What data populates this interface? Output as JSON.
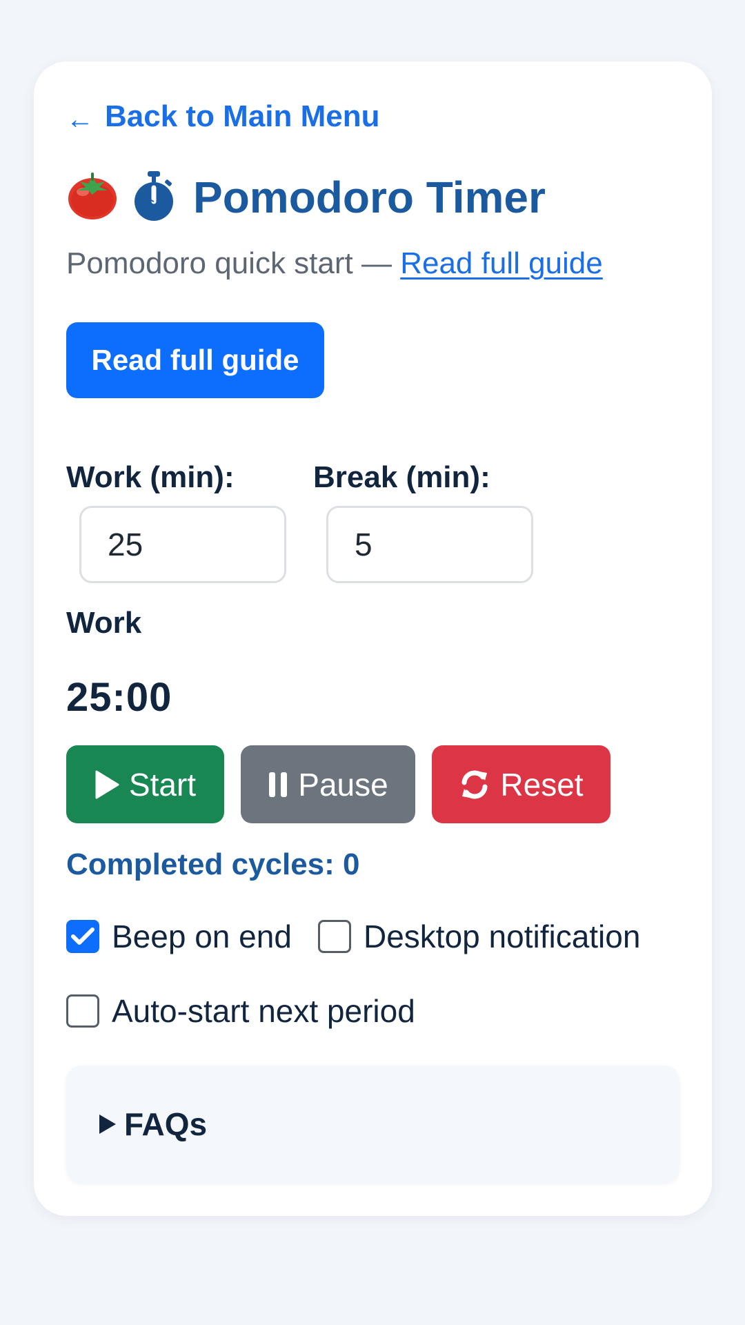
{
  "nav": {
    "back_arrow": "←",
    "back_label": "Back to Main Menu"
  },
  "header": {
    "title": "Pomodoro Timer",
    "icons": [
      "tomato-icon",
      "stopwatch-icon"
    ]
  },
  "subtitle": {
    "text": "Pomodoro quick start — ",
    "link_label": "Read full guide"
  },
  "guide_button": {
    "label": "Read full guide"
  },
  "settings": {
    "work_label": "Work (min):",
    "work_value": "25",
    "break_label": "Break (min):",
    "break_value": "5"
  },
  "timer": {
    "phase": "Work",
    "time": "25:00"
  },
  "controls": {
    "start_label": "Start",
    "pause_label": "Pause",
    "reset_label": "Reset",
    "start_icon": "play-icon",
    "pause_icon": "pause-icon",
    "reset_icon": "refresh-icon"
  },
  "cycles": {
    "text": "Completed cycles: 0"
  },
  "options": {
    "beep": {
      "label": "Beep on end",
      "checked": true
    },
    "desktop": {
      "label": "Desktop notification",
      "checked": false
    },
    "autostart": {
      "label": "Auto-start next period",
      "checked": false
    }
  },
  "faq": {
    "label": "FAQs"
  },
  "colors": {
    "accent": "#0d6efd",
    "link": "#1a6fe6",
    "title": "#1c5aa0",
    "start": "#198754",
    "pause": "#6c757d",
    "reset": "#dc3545",
    "background": "#f2f5fa"
  }
}
